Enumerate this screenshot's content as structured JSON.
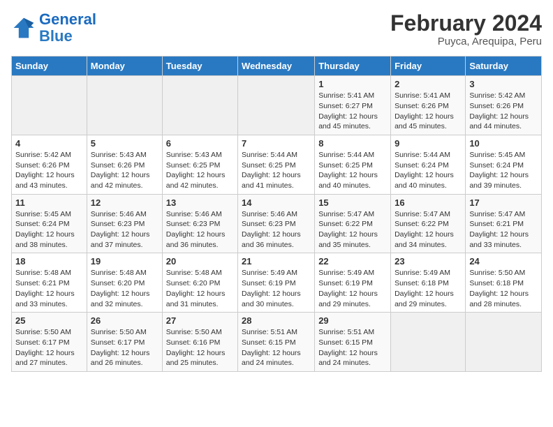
{
  "header": {
    "logo_line1": "General",
    "logo_line2": "Blue",
    "title": "February 2024",
    "subtitle": "Puyca, Arequipa, Peru"
  },
  "weekdays": [
    "Sunday",
    "Monday",
    "Tuesday",
    "Wednesday",
    "Thursday",
    "Friday",
    "Saturday"
  ],
  "weeks": [
    [
      {
        "day": "",
        "info": ""
      },
      {
        "day": "",
        "info": ""
      },
      {
        "day": "",
        "info": ""
      },
      {
        "day": "",
        "info": ""
      },
      {
        "day": "1",
        "info": "Sunrise: 5:41 AM\nSunset: 6:27 PM\nDaylight: 12 hours and 45 minutes."
      },
      {
        "day": "2",
        "info": "Sunrise: 5:41 AM\nSunset: 6:26 PM\nDaylight: 12 hours and 45 minutes."
      },
      {
        "day": "3",
        "info": "Sunrise: 5:42 AM\nSunset: 6:26 PM\nDaylight: 12 hours and 44 minutes."
      }
    ],
    [
      {
        "day": "4",
        "info": "Sunrise: 5:42 AM\nSunset: 6:26 PM\nDaylight: 12 hours and 43 minutes."
      },
      {
        "day": "5",
        "info": "Sunrise: 5:43 AM\nSunset: 6:26 PM\nDaylight: 12 hours and 42 minutes."
      },
      {
        "day": "6",
        "info": "Sunrise: 5:43 AM\nSunset: 6:25 PM\nDaylight: 12 hours and 42 minutes."
      },
      {
        "day": "7",
        "info": "Sunrise: 5:44 AM\nSunset: 6:25 PM\nDaylight: 12 hours and 41 minutes."
      },
      {
        "day": "8",
        "info": "Sunrise: 5:44 AM\nSunset: 6:25 PM\nDaylight: 12 hours and 40 minutes."
      },
      {
        "day": "9",
        "info": "Sunrise: 5:44 AM\nSunset: 6:24 PM\nDaylight: 12 hours and 40 minutes."
      },
      {
        "day": "10",
        "info": "Sunrise: 5:45 AM\nSunset: 6:24 PM\nDaylight: 12 hours and 39 minutes."
      }
    ],
    [
      {
        "day": "11",
        "info": "Sunrise: 5:45 AM\nSunset: 6:24 PM\nDaylight: 12 hours and 38 minutes."
      },
      {
        "day": "12",
        "info": "Sunrise: 5:46 AM\nSunset: 6:23 PM\nDaylight: 12 hours and 37 minutes."
      },
      {
        "day": "13",
        "info": "Sunrise: 5:46 AM\nSunset: 6:23 PM\nDaylight: 12 hours and 36 minutes."
      },
      {
        "day": "14",
        "info": "Sunrise: 5:46 AM\nSunset: 6:23 PM\nDaylight: 12 hours and 36 minutes."
      },
      {
        "day": "15",
        "info": "Sunrise: 5:47 AM\nSunset: 6:22 PM\nDaylight: 12 hours and 35 minutes."
      },
      {
        "day": "16",
        "info": "Sunrise: 5:47 AM\nSunset: 6:22 PM\nDaylight: 12 hours and 34 minutes."
      },
      {
        "day": "17",
        "info": "Sunrise: 5:47 AM\nSunset: 6:21 PM\nDaylight: 12 hours and 33 minutes."
      }
    ],
    [
      {
        "day": "18",
        "info": "Sunrise: 5:48 AM\nSunset: 6:21 PM\nDaylight: 12 hours and 33 minutes."
      },
      {
        "day": "19",
        "info": "Sunrise: 5:48 AM\nSunset: 6:20 PM\nDaylight: 12 hours and 32 minutes."
      },
      {
        "day": "20",
        "info": "Sunrise: 5:48 AM\nSunset: 6:20 PM\nDaylight: 12 hours and 31 minutes."
      },
      {
        "day": "21",
        "info": "Sunrise: 5:49 AM\nSunset: 6:19 PM\nDaylight: 12 hours and 30 minutes."
      },
      {
        "day": "22",
        "info": "Sunrise: 5:49 AM\nSunset: 6:19 PM\nDaylight: 12 hours and 29 minutes."
      },
      {
        "day": "23",
        "info": "Sunrise: 5:49 AM\nSunset: 6:18 PM\nDaylight: 12 hours and 29 minutes."
      },
      {
        "day": "24",
        "info": "Sunrise: 5:50 AM\nSunset: 6:18 PM\nDaylight: 12 hours and 28 minutes."
      }
    ],
    [
      {
        "day": "25",
        "info": "Sunrise: 5:50 AM\nSunset: 6:17 PM\nDaylight: 12 hours and 27 minutes."
      },
      {
        "day": "26",
        "info": "Sunrise: 5:50 AM\nSunset: 6:17 PM\nDaylight: 12 hours and 26 minutes."
      },
      {
        "day": "27",
        "info": "Sunrise: 5:50 AM\nSunset: 6:16 PM\nDaylight: 12 hours and 25 minutes."
      },
      {
        "day": "28",
        "info": "Sunrise: 5:51 AM\nSunset: 6:15 PM\nDaylight: 12 hours and 24 minutes."
      },
      {
        "day": "29",
        "info": "Sunrise: 5:51 AM\nSunset: 6:15 PM\nDaylight: 12 hours and 24 minutes."
      },
      {
        "day": "",
        "info": ""
      },
      {
        "day": "",
        "info": ""
      }
    ]
  ]
}
